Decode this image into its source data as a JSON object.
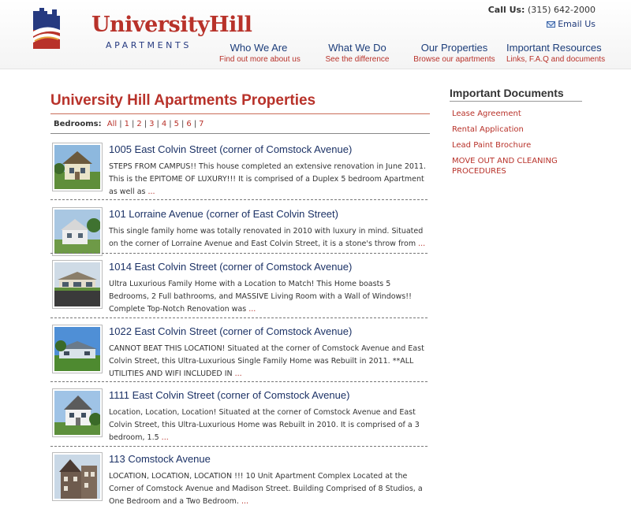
{
  "brand": {
    "word_part1": "University",
    "word_part2": "Hill",
    "subtitle": "APARTMENTS",
    "colors": {
      "red": "#b8322a",
      "navy": "#263a80"
    }
  },
  "contact": {
    "call_label": "Call Us:",
    "phone": "(315) 642-2000",
    "email_label": "Email Us",
    "email_icon": "envelope-icon"
  },
  "nav": [
    {
      "title": "Who We Are",
      "subtitle": "Find out more about us"
    },
    {
      "title": "What We Do",
      "subtitle": "See the difference"
    },
    {
      "title": "Our Properties",
      "subtitle": "Browse our apartments"
    },
    {
      "title": "Important Resources",
      "subtitle": "Links, F.A.Q and documents"
    }
  ],
  "main": {
    "title": "University Hill Apartments Properties",
    "filter_label": "Bedrooms:",
    "filter_options": [
      "All",
      "1",
      "2",
      "3",
      "4",
      "5",
      "6",
      "7"
    ]
  },
  "listings": [
    {
      "name": "1005 East Colvin Street (corner of Comstock Avenue)",
      "desc": "STEPS FROM CAMPUS!! This house completed an extensive renovation in June 2011. This is the EPITOME OF LUXURY!!! It is comprised of a Duplex 5 bedroom Apartment as well as",
      "more": "..."
    },
    {
      "name": "101 Lorraine Avenue (corner of East Colvin Street)",
      "desc": "This single family home was totally renovated in 2010 with luxury in mind. Situated on the corner of Lorraine Avenue and East Colvin Street, it is a stone's throw from",
      "more": "..."
    },
    {
      "name": "1014 East Colvin Street (corner of Comstock Avenue)",
      "desc": "Ultra Luxurious  Family Home with a Location to Match! This Home boasts 5 Bedrooms, 2 Full bathrooms,  and MASSIVE Living Room with a Wall of Windows!! Complete Top-Notch Renovation was",
      "more": "..."
    },
    {
      "name": "1022 East Colvin Street (corner of Comstock Avenue)",
      "desc": "CANNOT BEAT THIS LOCATION! Situated at the corner of Comstock Avenue and East Colvin Street, this Ultra-Luxurious Single Family Home was Rebuilt in 2011.  **ALL UTILITIES AND WIFI INCLUDED IN",
      "more": "..."
    },
    {
      "name": "1111 East Colvin Street (corner of Comstock Avenue)",
      "desc": "Location, Location, Location! Situated at the corner of Comstock Avenue and East Colvin Street, this Ultra-Luxurious Home was Rebuilt in 2010. It is comprised of a 3 bedroom, 1.5",
      "more": "..."
    },
    {
      "name": "113 Comstock Avenue",
      "desc": "LOCATION, LOCATION, LOCATION !!!  10 Unit Apartment Complex Located at the Corner of Comstock Avenue and Madison Street.   Building Comprised of 8 Studios,  a One Bedroom and a Two Bedroom.",
      "more": "..."
    }
  ],
  "sidebar": {
    "title": "Important Documents",
    "links": [
      "Lease Agreement",
      "Rental Application",
      "Lead Paint Brochure",
      "MOVE OUT AND CLEANING PROCEDURES"
    ]
  }
}
